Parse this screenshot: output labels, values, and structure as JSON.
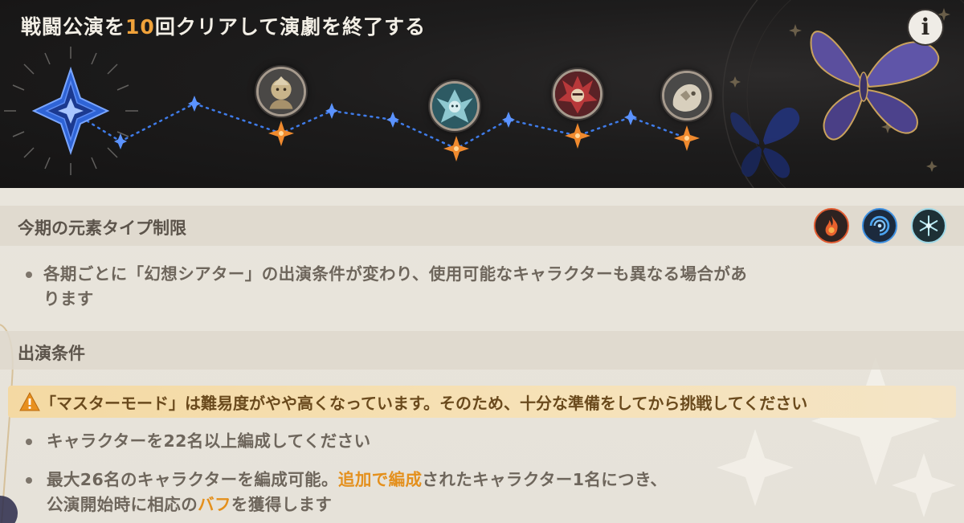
{
  "header": {
    "title_pre": "戦闘公演を",
    "title_count": "10",
    "title_post": "回クリアして演劇を終了する",
    "info_label": "i"
  },
  "stages": [
    {
      "name": "enemy-portrait-1"
    },
    {
      "name": "enemy-portrait-2"
    },
    {
      "name": "enemy-portrait-3"
    },
    {
      "name": "enemy-portrait-4"
    }
  ],
  "element_limit": {
    "title": "今期の元素タイプ制限",
    "icons": [
      "pyro-icon",
      "hydro-icon",
      "cryo-icon"
    ],
    "note": "各期ごとに「幻想シアター」の出演条件が変わり、使用可能なキャラクターも異なる場合があります",
    "note_line1": "各期ごとに「幻想シアター」の出演条件が変わり、使用可能なキャラクターも異なる場合があ",
    "note_line2": "ります"
  },
  "conditions": {
    "title": "出演条件",
    "warning": "「マスターモード」は難易度がやや高くなっています。そのため、十分な準備をしてから挑戦してください",
    "bullet1": "キャラクターを22名以上編成してください",
    "bullet2_a": "最大26名のキャラクターを編成可能。",
    "bullet2_hl1": "追加で編成",
    "bullet2_b": "されたキャラクター1名につき、",
    "bullet2_c": "公演開始時に相応の",
    "bullet2_hl2": "バフ",
    "bullet2_d": "を獲得します"
  },
  "colors": {
    "accent_orange": "#f0a23a",
    "banner_bg": "#1a1919",
    "content_bg": "#e9e5dc",
    "pyro": "#e0552c",
    "hydro": "#3d8fe0",
    "cryo": "#9fd8e6",
    "path_blue": "#3f7be8",
    "star_orange": "#f08a2e"
  }
}
